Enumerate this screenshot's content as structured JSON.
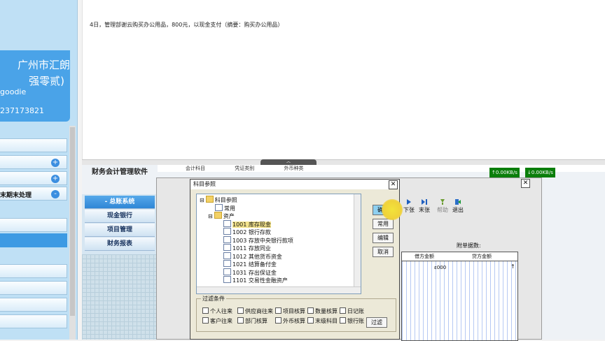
{
  "left_panel": {
    "company_line1": "广州市汇朗",
    "company_line2": "强零贰)",
    "username": "goodie",
    "phone": "237173821",
    "nav_items": [
      {
        "label": "",
        "icon": ""
      },
      {
        "label": "",
        "icon": "plus-icon"
      },
      {
        "label": "",
        "icon": "plus-icon"
      },
      {
        "label": "末期末处理",
        "icon": "minus-icon"
      },
      {
        "label": "",
        "icon": ""
      },
      {
        "label": "",
        "icon": ""
      },
      {
        "label": "",
        "icon": ""
      }
    ]
  },
  "note_text": "4日，管理部谢云购买办公用品，800元，以现金支付（摘要：购买办公用品）",
  "app": {
    "title": "财务会计管理软件",
    "tabs": [
      "会计科目",
      "凭证类别",
      "外币种类"
    ],
    "net_up": "↑0.00KB/s",
    "net_down": "↓0.00KB/s",
    "nav": [
      {
        "label": "- 总账系统"
      },
      {
        "label": "现金银行"
      },
      {
        "label": "项目管理"
      },
      {
        "label": "财务报表"
      }
    ],
    "toolbar": {
      "next_label": "下张",
      "last_label": "末张",
      "help_label": "帮助",
      "exit_label": "退出"
    },
    "attachments_label": "附单据数:",
    "grid_headers": [
      "借方金额",
      "贷方金额"
    ],
    "grid_cell": "ε000"
  },
  "dialog": {
    "title": "科目参照",
    "close": "✕",
    "tree": [
      {
        "label": "科目参照",
        "type": "folder",
        "indent": 0,
        "toggle": "⊟"
      },
      {
        "label": "常用",
        "type": "doc",
        "indent": 1,
        "toggle": ""
      },
      {
        "label": "资产",
        "type": "folder",
        "indent": 1,
        "toggle": "⊟"
      },
      {
        "label": "1001 库存现金",
        "type": "doc",
        "indent": 2,
        "toggle": "",
        "selected": true
      },
      {
        "label": "1002 银行存款",
        "type": "doc",
        "indent": 2,
        "toggle": ""
      },
      {
        "label": "1003 存放中央银行款项",
        "type": "doc",
        "indent": 2,
        "toggle": ""
      },
      {
        "label": "1011 存放同业",
        "type": "doc",
        "indent": 2,
        "toggle": ""
      },
      {
        "label": "1012 其他货币资金",
        "type": "doc",
        "indent": 2,
        "toggle": ""
      },
      {
        "label": "1021 结算备付金",
        "type": "doc",
        "indent": 2,
        "toggle": ""
      },
      {
        "label": "1031 存出保证金",
        "type": "doc",
        "indent": 2,
        "toggle": ""
      },
      {
        "label": "1101 交易性金融资产",
        "type": "doc",
        "indent": 2,
        "toggle": ""
      }
    ],
    "buttons": {
      "confirm": "确定",
      "common": "常用",
      "edit": "编辑",
      "cancel": "取消"
    },
    "filter": {
      "title": "过滤条件",
      "row1": [
        "个人往来",
        "供应商往来",
        "项目核算",
        "数量核算",
        "日记账"
      ],
      "row2": [
        "客户往来",
        "部门核算",
        "外币核算",
        "末级科目",
        "银行账"
      ],
      "button": "过滤"
    }
  }
}
